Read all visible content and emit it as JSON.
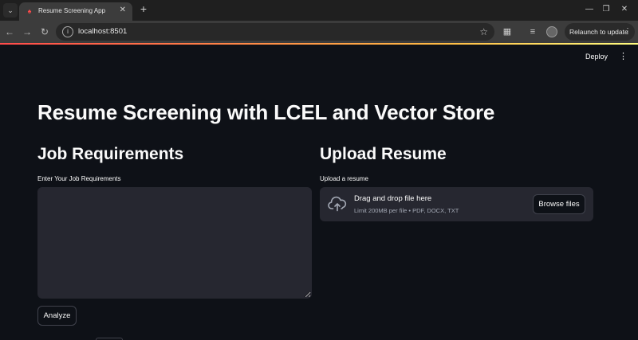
{
  "browser": {
    "tab_title": "Resume Screening App",
    "url": "localhost:8501",
    "relaunch_label": "Relaunch to update"
  },
  "header": {
    "deploy_label": "Deploy"
  },
  "main": {
    "title": "Resume Screening with LCEL and Vector Store",
    "job": {
      "heading": "Job Requirements",
      "field_label": "Enter Your Job Requirements",
      "value": "",
      "analyze_label": "Analyze"
    },
    "upload": {
      "heading": "Upload Resume",
      "field_label": "Upload a resume",
      "dropzone_title": "Drag and drop file here",
      "dropzone_limit": "Limit 200MB per file • PDF, DOCX, TXT",
      "browse_label": "Browse files"
    }
  },
  "colors": {
    "background": "#0e1117",
    "input_background": "#262730",
    "accent": "#ff4b4b",
    "text": "#fafafa"
  },
  "icons": [
    "tab-list-icon",
    "streamlit-favicon-icon",
    "close-icon",
    "plus-icon",
    "minimize-icon",
    "restore-icon",
    "back-icon",
    "forward-icon",
    "reload-icon",
    "site-info-icon",
    "star-icon",
    "extensions-icon",
    "tab-search-icon",
    "kebab-icon",
    "cloud-upload-icon"
  ]
}
